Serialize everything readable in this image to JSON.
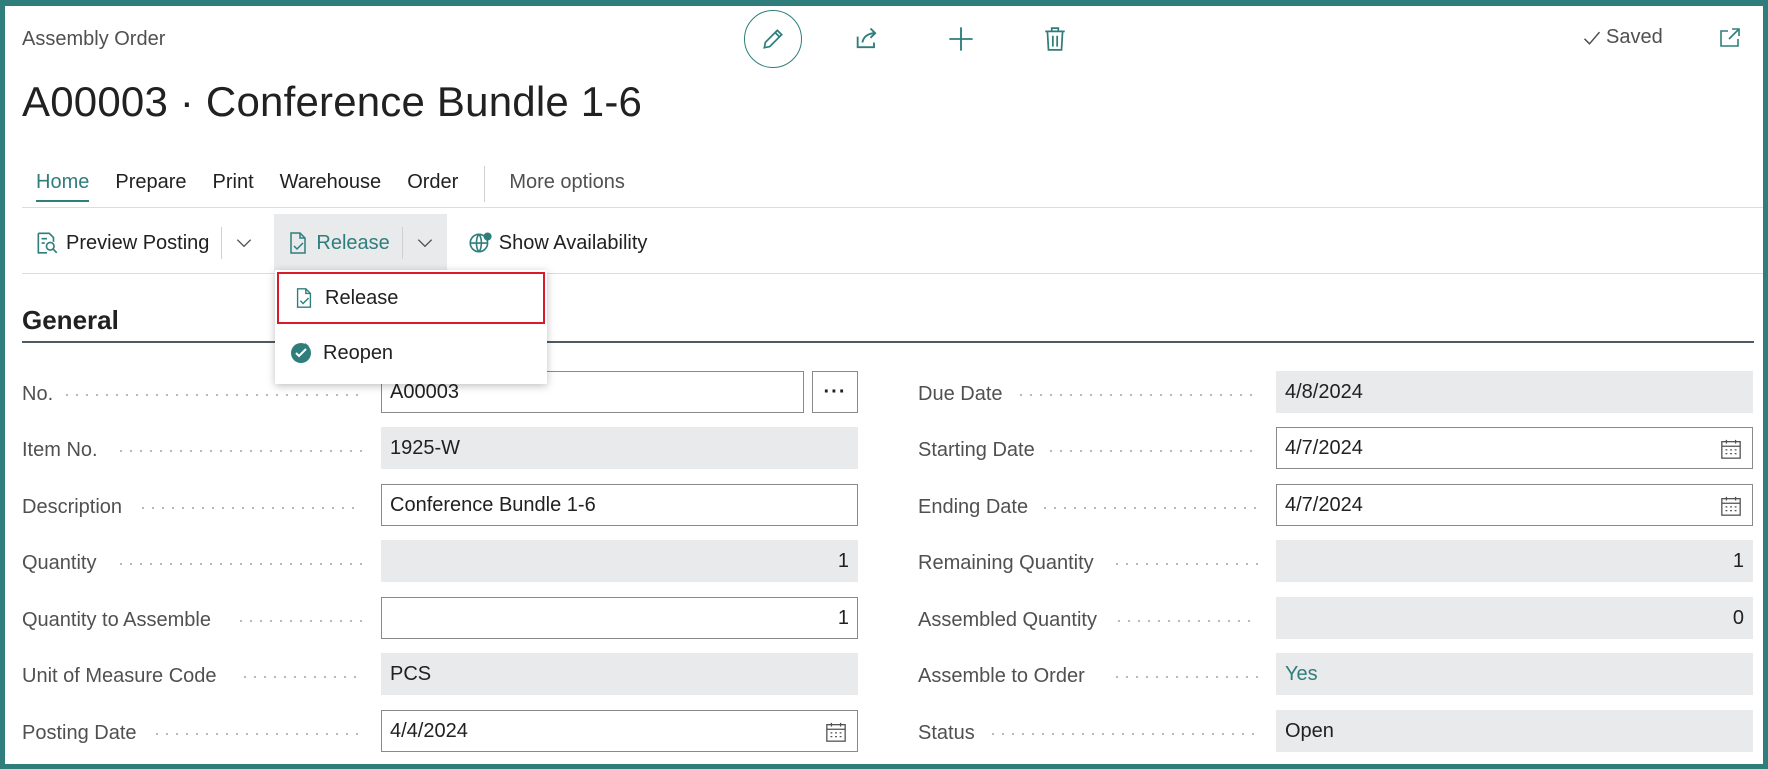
{
  "header": {
    "page_label": "Assembly Order",
    "title": "A00003 · Conference Bundle 1-6",
    "saved_label": "Saved"
  },
  "tabs": [
    "Home",
    "Prepare",
    "Print",
    "Warehouse",
    "Order",
    "More options"
  ],
  "actions": {
    "preview_posting": "Preview Posting",
    "release": "Release",
    "show_availability": "Show Availability"
  },
  "dropdown": {
    "items": [
      "Release",
      "Reopen"
    ]
  },
  "section": {
    "title": "General"
  },
  "left_fields": [
    {
      "label": "No.",
      "value": "A00003"
    },
    {
      "label": "Item No.",
      "value": "1925-W"
    },
    {
      "label": "Description",
      "value": "Conference Bundle 1-6"
    },
    {
      "label": "Quantity",
      "value": "1"
    },
    {
      "label": "Quantity to Assemble",
      "value": "1"
    },
    {
      "label": "Unit of Measure Code",
      "value": "PCS"
    },
    {
      "label": "Posting Date",
      "value": "4/4/2024"
    }
  ],
  "right_fields": [
    {
      "label": "Due Date",
      "value": "4/8/2024"
    },
    {
      "label": "Starting Date",
      "value": "4/7/2024"
    },
    {
      "label": "Ending Date",
      "value": "4/7/2024"
    },
    {
      "label": "Remaining Quantity",
      "value": "1"
    },
    {
      "label": "Assembled Quantity",
      "value": "0"
    },
    {
      "label": "Assemble to Order",
      "value": "Yes"
    },
    {
      "label": "Status",
      "value": "Open"
    }
  ],
  "colors": {
    "accent": "#2f7e7c",
    "highlight_border": "#d81b2b",
    "readonly_bg": "#e9eaeb"
  },
  "icons": [
    "edit-icon",
    "share-icon",
    "plus-icon",
    "delete-icon",
    "checkmark-icon",
    "popout-icon",
    "preview-posting-icon",
    "chevron-down-icon",
    "release-doc-icon",
    "show-availability-icon",
    "reopen-icon",
    "calendar-icon",
    "ellipsis-icon"
  ]
}
